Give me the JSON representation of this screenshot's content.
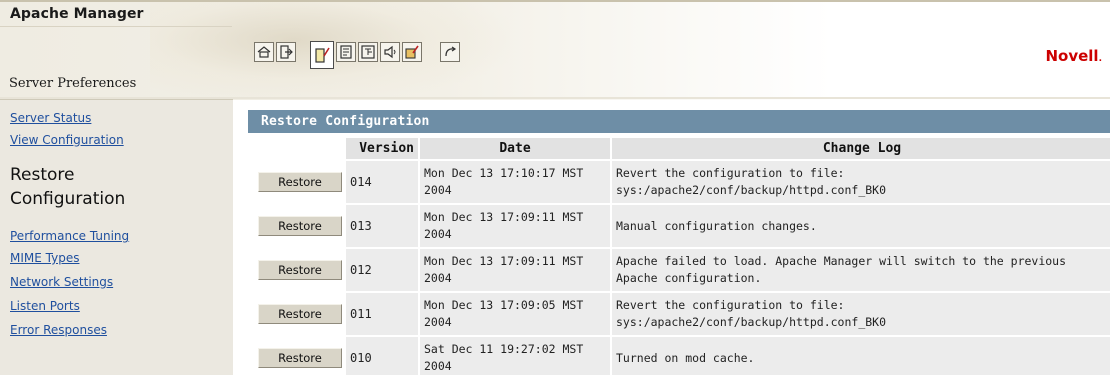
{
  "app": {
    "title": "Apache Manager",
    "brand": "Novell",
    "brand_dot": ".",
    "brand_color": "#cc0000",
    "section": "Server Preferences"
  },
  "toolbar": {
    "icons": [
      "home-icon",
      "exit-icon",
      "server-preferences-icon",
      "document-icon",
      "tree-icon",
      "speaker-icon",
      "edit-icon",
      "refresh-icon"
    ]
  },
  "sidebar": {
    "links_top": [
      {
        "label": "Server Status"
      },
      {
        "label": "View Configuration"
      }
    ],
    "current": "Restore Configuration",
    "links_bottom": [
      {
        "label": "Performance Tuning"
      },
      {
        "label": "MIME Types"
      },
      {
        "label": "Network Settings"
      },
      {
        "label": "Listen Ports"
      },
      {
        "label": "Error Responses"
      }
    ],
    "link_color": "#1f4f9e"
  },
  "panel": {
    "title": "Restore Configuration",
    "header_color": "#6e8ea6",
    "columns": {
      "version": "Version",
      "date": "Date",
      "log": "Change Log"
    },
    "rows": [
      {
        "button": "Restore",
        "version": "014",
        "date": "Mon Dec 13 17:10:17 MST 2004",
        "log": "Revert the configuration to file: sys:/apache2/conf/backup/httpd.conf_BK0"
      },
      {
        "button": "Restore",
        "version": "013",
        "date": "Mon Dec 13 17:09:11 MST 2004",
        "log": "Manual configuration changes."
      },
      {
        "button": "Restore",
        "version": "012",
        "date": "Mon Dec 13 17:09:11 MST 2004",
        "log": "Apache failed to load. Apache Manager will switch to the previous Apache configuration."
      },
      {
        "button": "Restore",
        "version": "011",
        "date": "Mon Dec 13 17:09:05 MST 2004",
        "log": "Revert the configuration to file: sys:/apache2/conf/backup/httpd.conf_BK0"
      },
      {
        "button": "Restore",
        "version": "010",
        "date": "Sat Dec 11 19:27:02 MST 2004",
        "log": "Turned on mod cache."
      }
    ]
  }
}
